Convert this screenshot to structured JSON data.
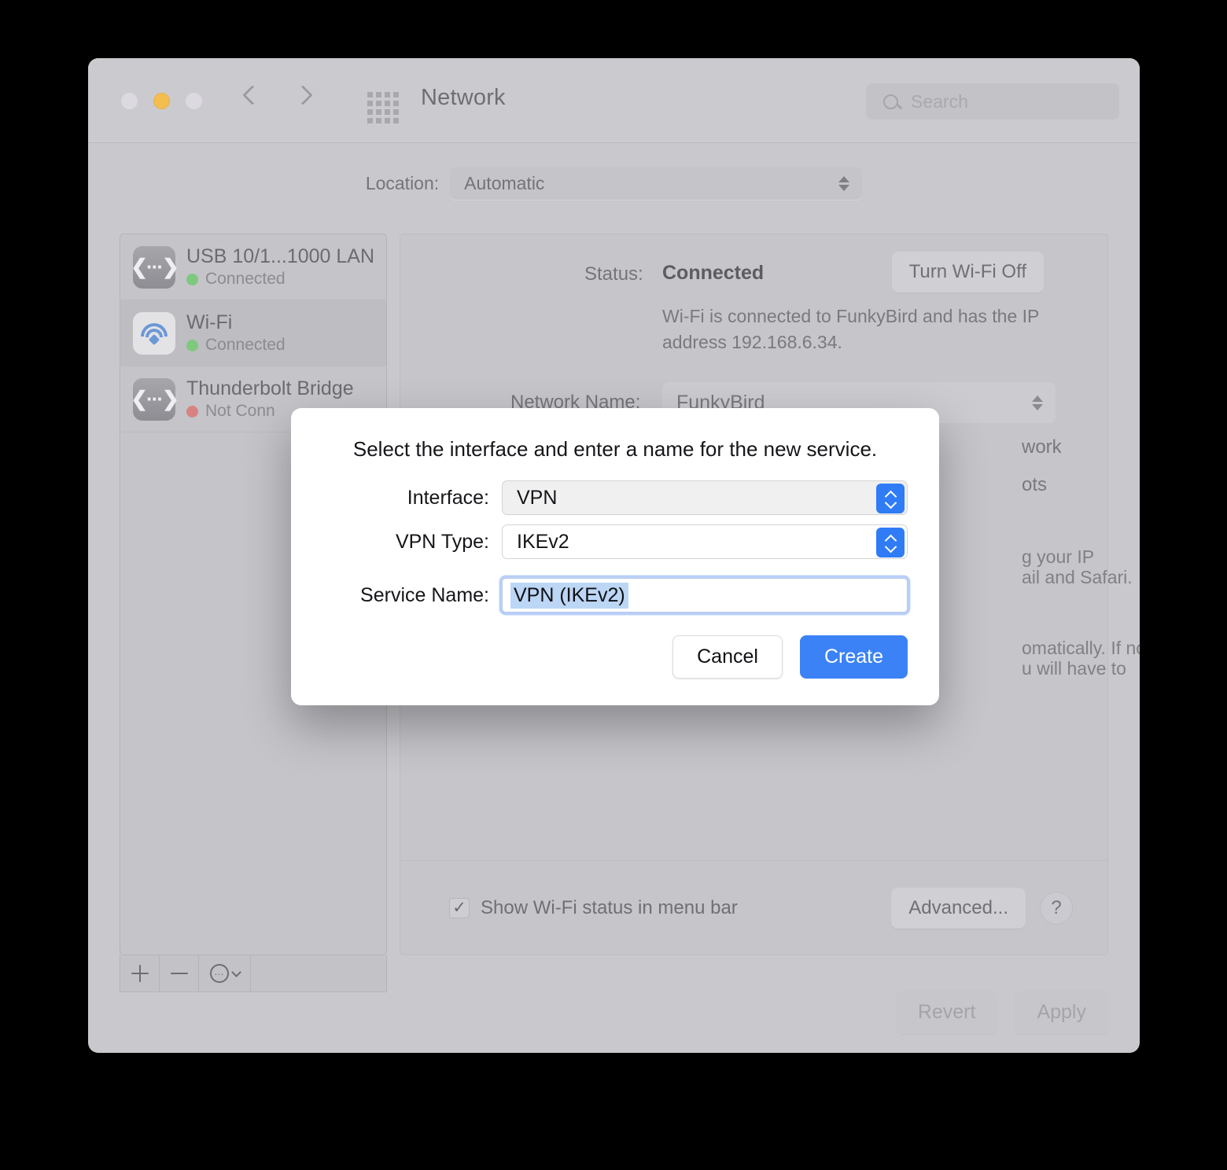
{
  "window": {
    "title": "Network",
    "traffic_lights": [
      "close",
      "minimize",
      "zoom"
    ],
    "search": {
      "placeholder": "Search",
      "value": ""
    },
    "accent_blue": "#3b82f6",
    "stepper_blue": "#2f7cf6"
  },
  "location": {
    "label": "Location:",
    "value": "Automatic"
  },
  "sidebar": {
    "services": [
      {
        "name": "USB 10/1...1000 LAN",
        "status": "Connected",
        "status_color": "#7ec97e",
        "icon": "ethernet-icon",
        "selected": false
      },
      {
        "name": "Wi-Fi",
        "status": "Connected",
        "status_color": "#7ec97e",
        "icon": "wifi-icon",
        "selected": true
      },
      {
        "name": "Thunderbolt Bridge",
        "status": "Not Conn",
        "status_color": "#d98282",
        "icon": "ethernet-icon",
        "selected": false
      }
    ],
    "toolbar": {
      "add_label": "+",
      "remove_label": "−",
      "action_icon": "ellipsis-circle-icon"
    }
  },
  "detail": {
    "status_label": "Status:",
    "status_value": "Connected",
    "wifi_toggle_label": "Turn Wi-Fi Off",
    "status_description": "Wi-Fi is connected to FunkyBird and has the IP address 192.168.6.34.",
    "network_name_label": "Network Name:",
    "network_name_value": "FunkyBird",
    "obscured": {
      "line1": "work",
      "line2": "ots",
      "line3": "g your IP",
      "line4": "ail and Safari.",
      "line5": "omatically. If no",
      "line6": "u will have to"
    },
    "show_status_label": "Show Wi-Fi status in menu bar",
    "show_status_checked": true,
    "check_glyph": "✓",
    "advanced_label": "Advanced...",
    "help_label": "?"
  },
  "footer": {
    "revert_label": "Revert",
    "apply_label": "Apply"
  },
  "dialog": {
    "headline": "Select the interface and enter a name for the new service.",
    "interface_label": "Interface:",
    "interface_value": "VPN",
    "vpn_type_label": "VPN Type:",
    "vpn_type_value": "IKEv2",
    "service_name_label": "Service Name:",
    "service_name_value": "VPN (IKEv2)",
    "cancel_label": "Cancel",
    "create_label": "Create"
  }
}
